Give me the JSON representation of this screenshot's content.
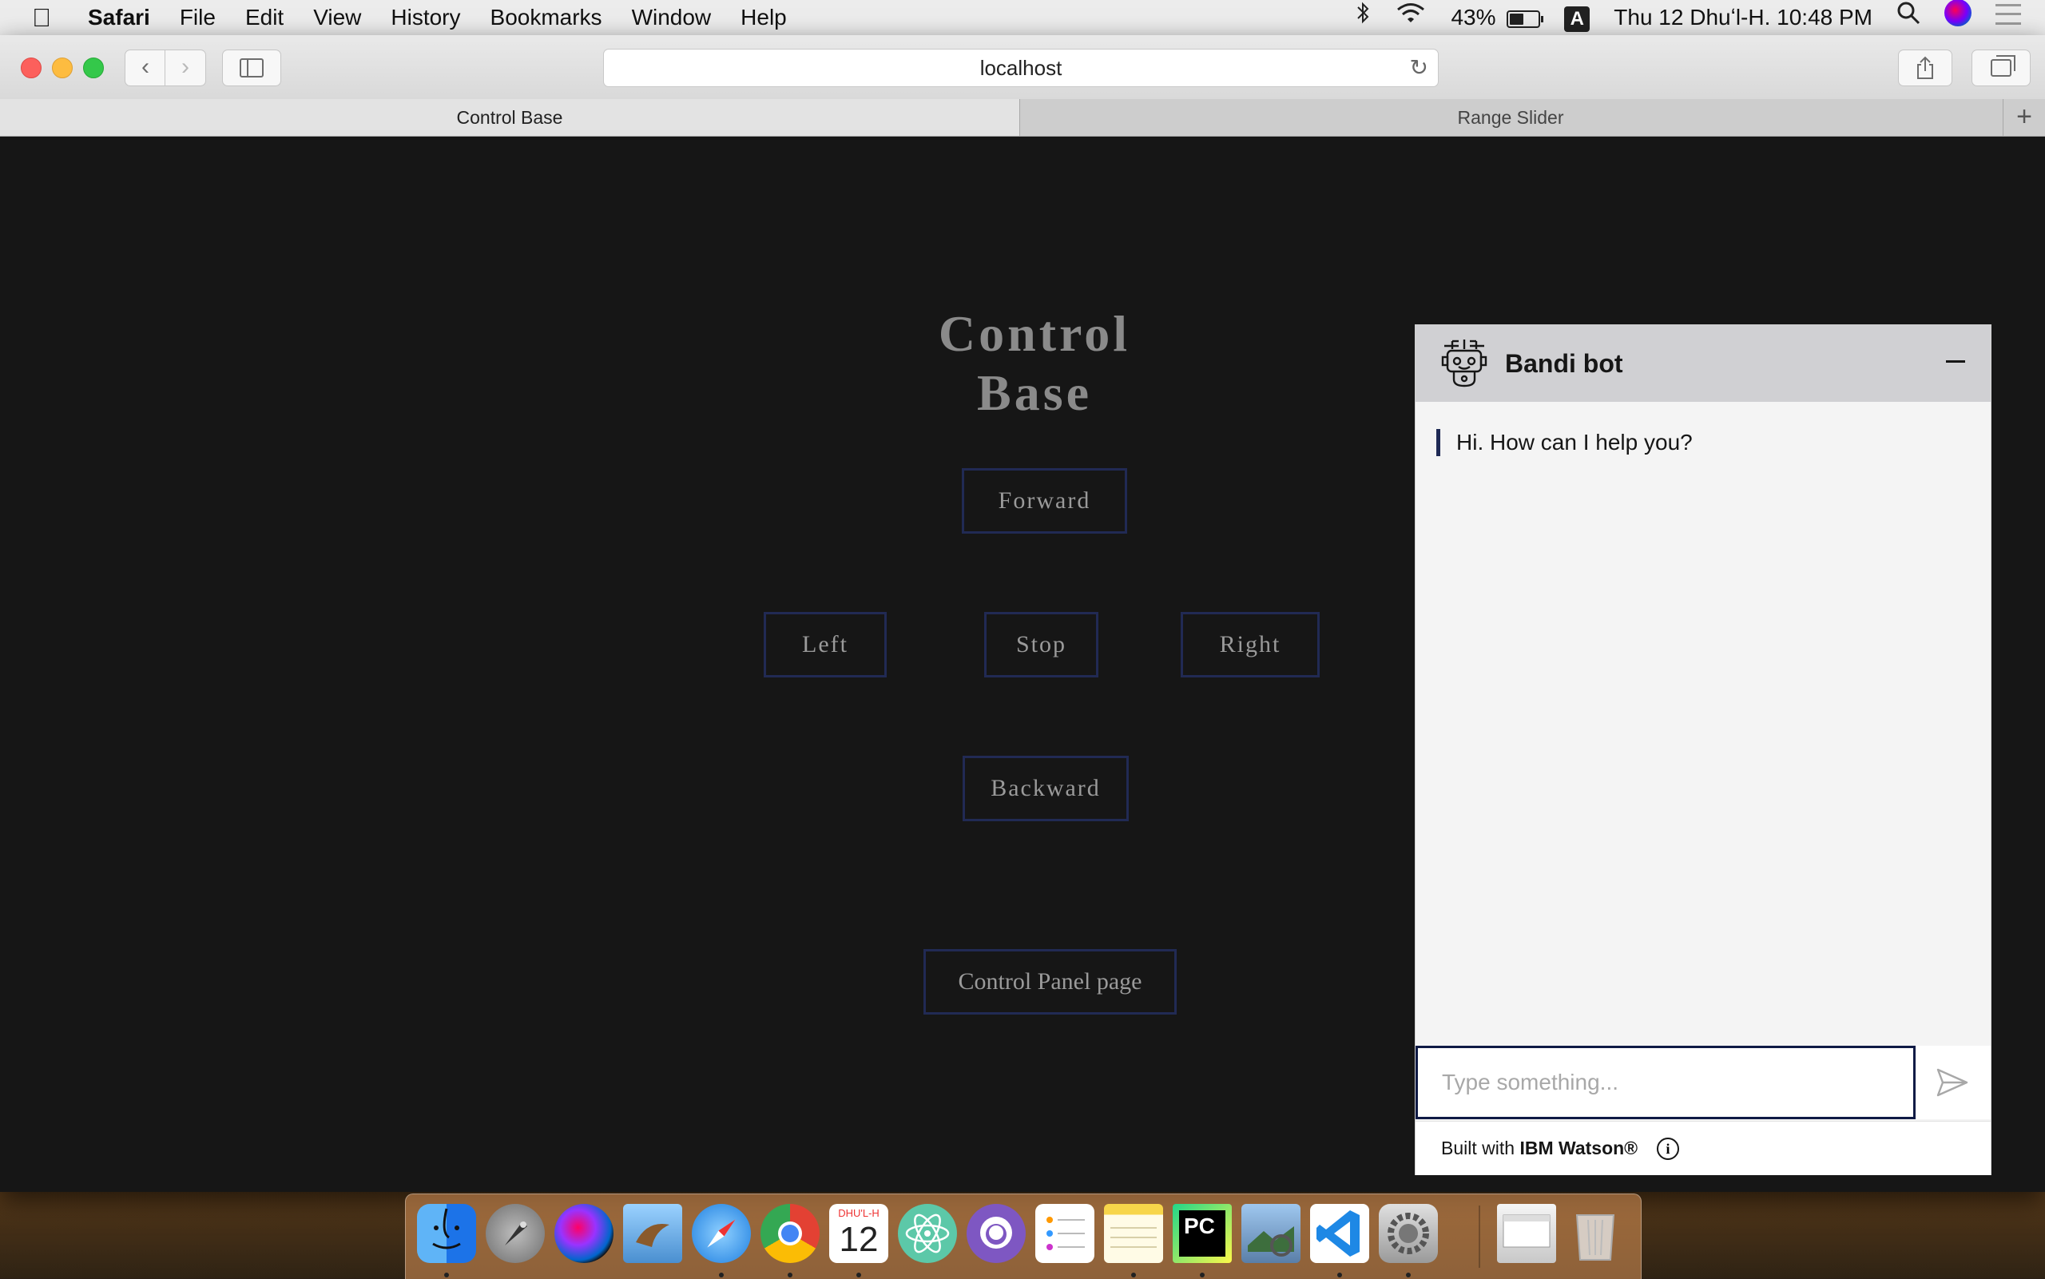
{
  "menubar": {
    "app": "Safari",
    "items": [
      "File",
      "Edit",
      "View",
      "History",
      "Bookmarks",
      "Window",
      "Help"
    ],
    "battery": "43%",
    "input_source": "A",
    "datetime": "Thu 12 Dhuʻl-H.  10:48 PM"
  },
  "browser": {
    "url": "localhost",
    "tabs": [
      {
        "label": "Control Base",
        "active": true
      },
      {
        "label": "Range Slider",
        "active": false
      }
    ]
  },
  "page": {
    "title": "Control Base",
    "buttons": {
      "forward": "Forward",
      "left": "Left",
      "stop": "Stop",
      "right": "Right",
      "backward": "Backward",
      "control_panel": "Control Panel page"
    }
  },
  "chat": {
    "bot_name": "Bandi bot",
    "messages": [
      "Hi. How can I help you?"
    ],
    "input_placeholder": "Type something...",
    "footer_prefix": "Built with ",
    "footer_brand": "IBM Watson®",
    "accent": "#1f2a55"
  },
  "dock": {
    "calendar_month": "DHU'L-H",
    "calendar_day": "12",
    "pycharm_label": "PC"
  }
}
